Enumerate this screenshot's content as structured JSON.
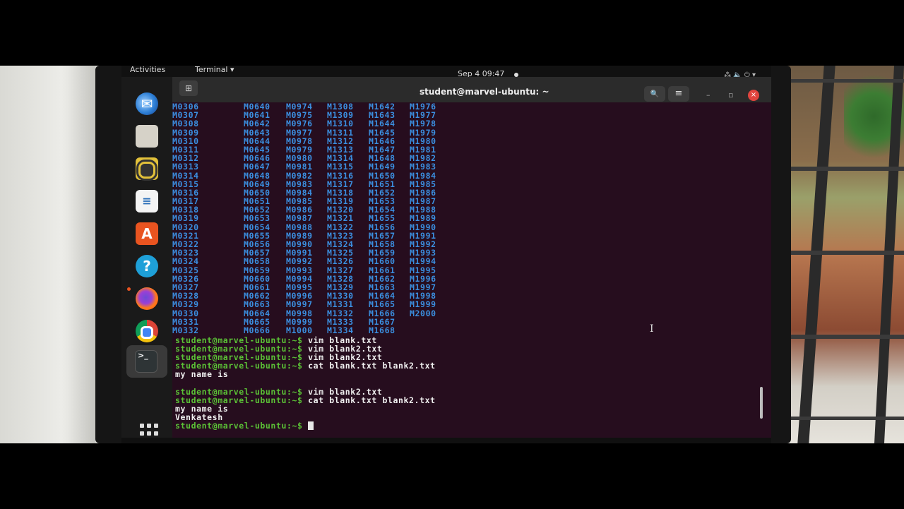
{
  "topbar": {
    "activities": "Activities",
    "app_menu": "Terminal ▾",
    "clock": "Sep 4  09:47",
    "system_icons": "⁂  🔈  ⏻ ▾"
  },
  "dock": {
    "items": [
      {
        "name": "Thunderbird"
      },
      {
        "name": "Files"
      },
      {
        "name": "Rhythmbox"
      },
      {
        "name": "LibreOffice Writer"
      },
      {
        "name": "Ubuntu Software"
      },
      {
        "name": "Help"
      },
      {
        "name": "Firefox"
      },
      {
        "name": "Chrome"
      },
      {
        "name": "Terminal"
      }
    ],
    "show_apps": "Show Applications"
  },
  "headerbar": {
    "title": "student@marvel-ubuntu: ~",
    "new_tab": "⊞",
    "search": "🔍",
    "menu": "≡",
    "minimize": "–",
    "maximize": "▫",
    "close": "×"
  },
  "listing": {
    "col1": [
      "M0306",
      "M0307",
      "M0308",
      "M0309",
      "M0310",
      "M0311",
      "M0312",
      "M0313",
      "M0314",
      "M0315",
      "M0316",
      "M0317",
      "M0318",
      "M0319",
      "M0320",
      "M0321",
      "M0322",
      "M0323",
      "M0324",
      "M0325",
      "M0326",
      "M0327",
      "M0328",
      "M0329",
      "M0330",
      "M0331",
      "M0332"
    ],
    "col2": [
      "M0640",
      "M0641",
      "M0642",
      "M0643",
      "M0644",
      "M0645",
      "M0646",
      "M0647",
      "M0648",
      "M0649",
      "M0650",
      "M0651",
      "M0652",
      "M0653",
      "M0654",
      "M0655",
      "M0656",
      "M0657",
      "M0658",
      "M0659",
      "M0660",
      "M0661",
      "M0662",
      "M0663",
      "M0664",
      "M0665",
      "M0666"
    ],
    "col3": [
      "M0974",
      "M0975",
      "M0976",
      "M0977",
      "M0978",
      "M0979",
      "M0980",
      "M0981",
      "M0982",
      "M0983",
      "M0984",
      "M0985",
      "M0986",
      "M0987",
      "M0988",
      "M0989",
      "M0990",
      "M0991",
      "M0992",
      "M0993",
      "M0994",
      "M0995",
      "M0996",
      "M0997",
      "M0998",
      "M0999",
      "M1000"
    ],
    "col4": [
      "M1308",
      "M1309",
      "M1310",
      "M1311",
      "M1312",
      "M1313",
      "M1314",
      "M1315",
      "M1316",
      "M1317",
      "M1318",
      "M1319",
      "M1320",
      "M1321",
      "M1322",
      "M1323",
      "M1324",
      "M1325",
      "M1326",
      "M1327",
      "M1328",
      "M1329",
      "M1330",
      "M1331",
      "M1332",
      "M1333",
      "M1334"
    ],
    "col5": [
      "M1642",
      "M1643",
      "M1644",
      "M1645",
      "M1646",
      "M1647",
      "M1648",
      "M1649",
      "M1650",
      "M1651",
      "M1652",
      "M1653",
      "M1654",
      "M1655",
      "M1656",
      "M1657",
      "M1658",
      "M1659",
      "M1660",
      "M1661",
      "M1662",
      "M1663",
      "M1664",
      "M1665",
      "M1666",
      "M1667",
      "M1668"
    ],
    "col6": [
      "M1976",
      "M1977",
      "M1978",
      "M1979",
      "M1980",
      "M1981",
      "M1982",
      "M1983",
      "M1984",
      "M1985",
      "M1986",
      "M1987",
      "M1988",
      "M1989",
      "M1990",
      "M1991",
      "M1992",
      "M1993",
      "M1994",
      "M1995",
      "M1996",
      "M1997",
      "M1998",
      "M1999",
      "M2000"
    ]
  },
  "session": {
    "prompt": "student@marvel-ubuntu:~$",
    "cmd1": "vim blank.txt",
    "cmd2": "vim blank2.txt",
    "cmd3": "vim blank2.txt",
    "cmd4": "cat blank.txt blank2.txt",
    "out1": "my name is",
    "cmd5": "vim blank2.txt",
    "cmd6": "cat blank.txt blank2.txt",
    "out2": "my name is",
    "out3": "Venkatesh"
  },
  "colors": {
    "terminal_bg": "#260d1e",
    "prompt_green": "#5bc236",
    "listing_blue": "#3b8fe0",
    "accent_orange": "#e95420"
  }
}
